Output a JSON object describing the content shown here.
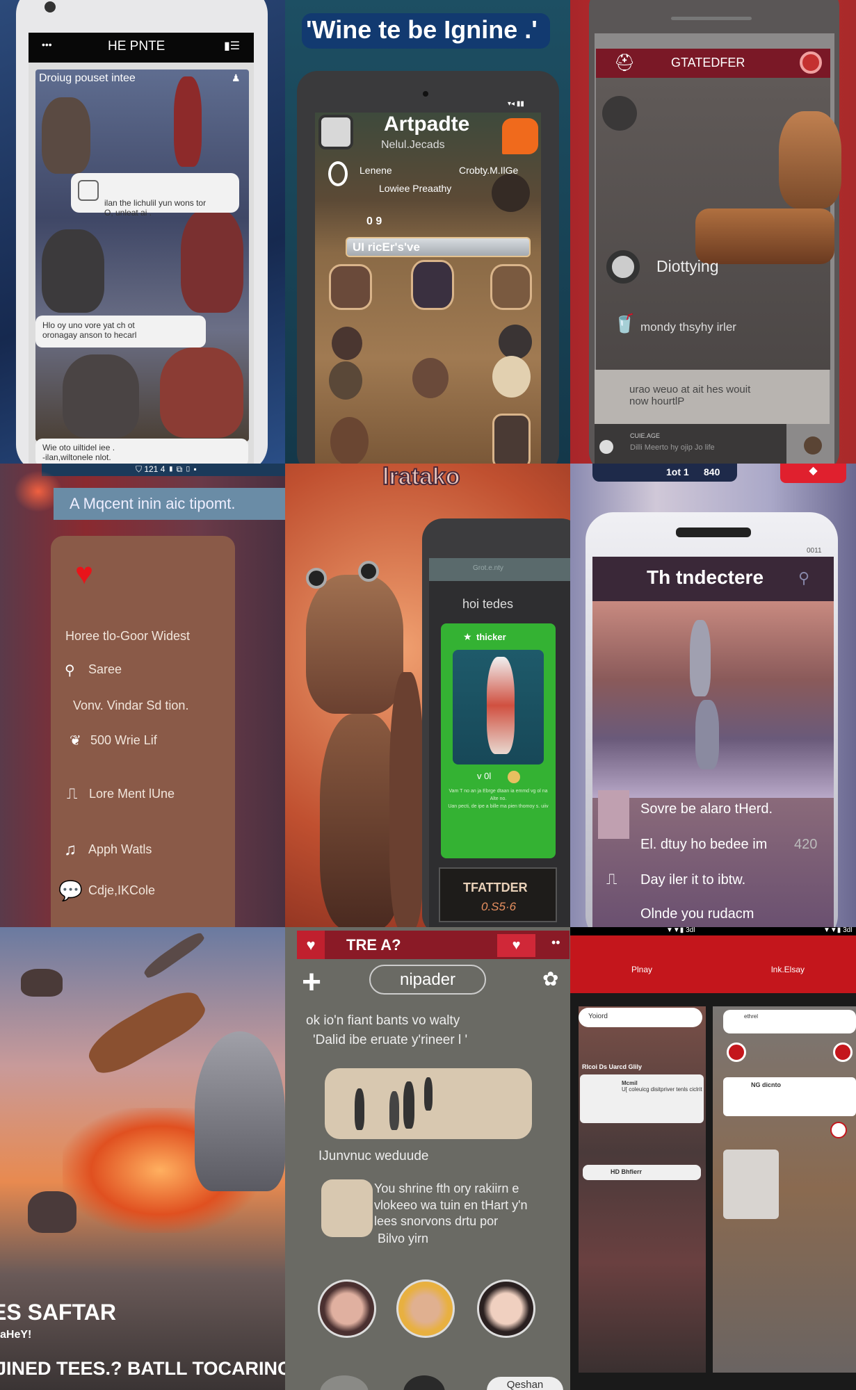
{
  "panels": {
    "p1": {
      "header": "HE PNTE",
      "card_title": "Droiug pouset intee",
      "bubble1": "ilan the lichulil yun wons tor\nO, unleat ai .",
      "bubble2": "Hlo oy uno vore yat ch ot\noronagay anson to hecarl",
      "bubble3": "Wie oto uiltidel iee .\n-ilan,wiltonele nlot."
    },
    "p2": {
      "banner": "'Wine te be Ignine .'",
      "app_title": "Artpadte",
      "subtitle": "Nelul.Jecads",
      "left_label": "Lenene",
      "right_label": "Crobty.M.IlGe",
      "status": "Lowiee Preaathy",
      "counter": "0 9",
      "search_value": "UI ricEr's've"
    },
    "p3": {
      "header": "GTATEDFER",
      "item1": "Diottying",
      "item2": "mondy thsyhy irler",
      "message": "urao weuo at ait hes wouit\nnow hourtlP",
      "footer_title": "CUIE.AGE",
      "footer_text": "Dilli Meerto hy ojip Jo life"
    },
    "p4": {
      "banner": "A Mqcent inin aic tipomt.",
      "items": [
        {
          "icon": "pin-icon",
          "label": "Horee tlo-Goor Widest"
        },
        {
          "icon": "location-pin-icon",
          "label": "Saree"
        },
        {
          "icon": "",
          "label": "Vonv. Vindar Sd tion."
        },
        {
          "icon": "leaf-icon",
          "label": "500 Wrie Lif"
        },
        {
          "icon": "bookmark-icon",
          "label": "Lore Ment lUne"
        },
        {
          "icon": "figure-icon",
          "label": "Apph Watls"
        },
        {
          "icon": "chat-bubble-icon",
          "label": "Cdje,IKCole"
        }
      ],
      "accent": "#e8141a"
    },
    "p5": {
      "title": "lratako",
      "screen_header": "Grot.e.nty",
      "screen_title": "hoi tedes",
      "card_title": "thicker",
      "rating": "v 0l",
      "card_text": "Vam T no an ja Ebrge dtaan ia emmd vg ol na Alte no.\nUan pecti, de ipe a bille ma pien thomoy s. uiiv",
      "footer_title": "TFATTDER",
      "footer_value": "0.S5·6",
      "card_color": "#34b233"
    },
    "p6": {
      "status_left": "1ot 1",
      "status_right": "840",
      "phone_status": "0011",
      "header": "Th tndectere",
      "lines": [
        "Sovre be alaro tHerd.",
        "El. dtuy ho bedee im",
        "Day iler it to ibtw.",
        "Olnde you rudacm"
      ],
      "badge": "420"
    },
    "p7": {
      "title": "ES SAFTAR",
      "subtitle": "aHeY!",
      "tagline": "JINED TEES.? BATLL TOCARINC,"
    },
    "p8": {
      "header": "TRE A?",
      "pill": "nipader",
      "line1": "ok io'n fiant bants vo walty",
      "line2": "'Dalid ibe eruate y'rineer l '",
      "caption": "IJunvnuc weduude",
      "card_text": [
        "You shrine fth ory rakiirn e",
        "vlokeeo wa tuin en tHart y'n",
        "lees snorvons drtu por",
        "Bilvo yirn"
      ],
      "button": "Qeshan",
      "accent": "#b0172a"
    },
    "p9": {
      "status": "▼▼▮ 3dl",
      "tab1": "Plnay",
      "tab2": "lnk.Elsay",
      "left_cards": [
        "Yoiord",
        "Rlcoi Ds Uarcd Glily",
        "Mcmil",
        "U[ coleuicg disitpriver tenls ciclrit",
        "HD Bhfierr"
      ],
      "right_cards": [
        "ethrel",
        "NG dicnto"
      ],
      "accent": "#c4161c"
    }
  }
}
